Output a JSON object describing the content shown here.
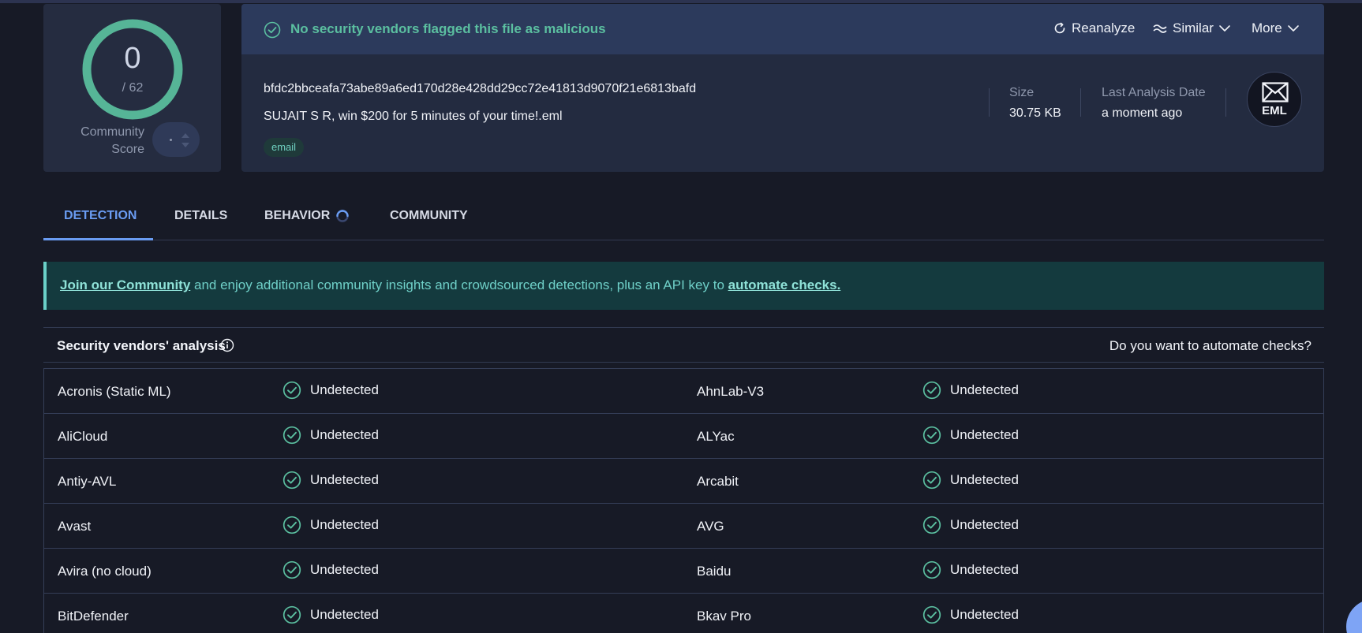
{
  "score": {
    "value": "0",
    "total": "/ 62",
    "label": "Community Score"
  },
  "verdict": {
    "text": "No security vendors flagged this file as malicious"
  },
  "actions": {
    "reanalyze": "Reanalyze",
    "similar": "Similar",
    "more": "More"
  },
  "file": {
    "hash": "bfdc2bbceafa73abe89a6ed170d28e428dd29cc72e41813d9070f21e6813bafd",
    "name": "SUJAIT S R, win $200 for 5 minutes of your time!.eml",
    "tag": "email",
    "size_label": "Size",
    "size_value": "30.75 KB",
    "date_label": "Last Analysis Date",
    "date_value": "a moment ago",
    "type_badge": "EML"
  },
  "tabs": [
    {
      "label": "DETECTION",
      "active": true
    },
    {
      "label": "DETAILS"
    },
    {
      "label": "BEHAVIOR"
    },
    {
      "label": "COMMUNITY"
    }
  ],
  "banner": {
    "link1": "Join our Community",
    "middle": " and enjoy additional community insights and crowdsourced detections, plus an API key to ",
    "link2": "automate checks."
  },
  "vendors": {
    "title": "Security vendors' analysis",
    "automate_prompt": "Do you want to automate checks?",
    "rows": [
      {
        "left": "Acronis (Static ML)",
        "left_status": "Undetected",
        "right": "AhnLab-V3",
        "right_status": "Undetected"
      },
      {
        "left": "AliCloud",
        "left_status": "Undetected",
        "right": "ALYac",
        "right_status": "Undetected"
      },
      {
        "left": "Antiy-AVL",
        "left_status": "Undetected",
        "right": "Arcabit",
        "right_status": "Undetected"
      },
      {
        "left": "Avast",
        "left_status": "Undetected",
        "right": "AVG",
        "right_status": "Undetected"
      },
      {
        "left": "Avira (no cloud)",
        "left_status": "Undetected",
        "right": "Baidu",
        "right_status": "Undetected"
      },
      {
        "left": "BitDefender",
        "left_status": "Undetected",
        "right": "Bkav Pro",
        "right_status": "Undetected"
      }
    ]
  },
  "colors": {
    "accent_green": "#5bbfa0",
    "accent_blue": "#6a9cf2",
    "background": "#171a26"
  },
  "icons": [
    "check-circle-icon",
    "reanalyze-icon",
    "similar-icon",
    "chevron-down-icon",
    "info-icon",
    "loading-spinner-icon",
    "eml-envelope-icon"
  ]
}
